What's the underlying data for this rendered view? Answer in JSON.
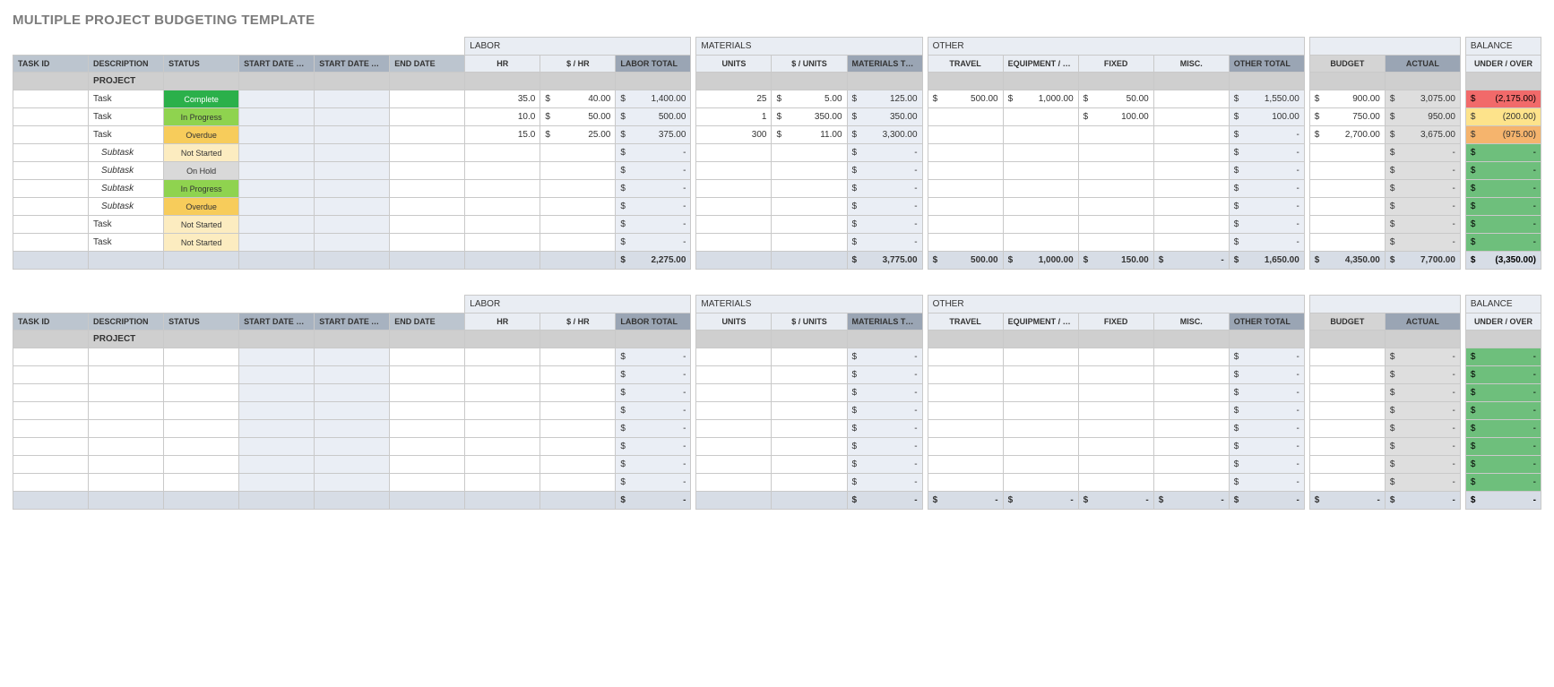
{
  "title": "MULTIPLE PROJECT BUDGETING TEMPLATE",
  "categories": {
    "labor": "LABOR",
    "materials": "MATERIALS",
    "other": "OTHER",
    "balance": "BALANCE"
  },
  "cols": {
    "task_id": "TASK ID",
    "description": "DESCRIPTION",
    "status": "STATUS",
    "start_planned": "START DATE PLANNED",
    "start_actual": "START DATE ACTUAL",
    "end_date": "END DATE",
    "hr": "HR",
    "per_hr": "$ / HR",
    "labor_total": "LABOR TOTAL",
    "units": "UNITS",
    "per_unit": "$ / UNITS",
    "materials_total": "MATERIALS TOTAL",
    "travel": "TRAVEL",
    "equipment": "EQUIPMENT / SPACE",
    "fixed": "FIXED",
    "misc": "MISC.",
    "other_total": "OTHER TOTAL",
    "budget": "BUDGET",
    "actual": "ACTUAL",
    "under_over": "UNDER / OVER"
  },
  "status_labels": {
    "complete": "Complete",
    "inprogress": "In Progress",
    "overdue": "Overdue",
    "notstarted": "Not Started",
    "onhold": "On Hold"
  },
  "projects": [
    {
      "section_label": "PROJECT",
      "rows": [
        {
          "desc": "Task",
          "sub": false,
          "status": "complete",
          "hr": "35.0",
          "per_hr": "40.00",
          "labor_total": "1,400.00",
          "units": "25",
          "per_unit": "5.00",
          "materials_total": "125.00",
          "travel": "500.00",
          "equipment": "1,000.00",
          "fixed": "50.00",
          "misc": "",
          "other_total": "1,550.00",
          "budget": "900.00",
          "actual": "3,075.00",
          "balance": "(2,175.00)",
          "balance_class": "bal-red"
        },
        {
          "desc": "Task",
          "sub": false,
          "status": "inprogress",
          "hr": "10.0",
          "per_hr": "50.00",
          "labor_total": "500.00",
          "units": "1",
          "per_unit": "350.00",
          "materials_total": "350.00",
          "travel": "",
          "equipment": "",
          "fixed": "100.00",
          "misc": "",
          "other_total": "100.00",
          "budget": "750.00",
          "actual": "950.00",
          "balance": "(200.00)",
          "balance_class": "bal-yellow"
        },
        {
          "desc": "Task",
          "sub": false,
          "status": "overdue",
          "hr": "15.0",
          "per_hr": "25.00",
          "labor_total": "375.00",
          "units": "300",
          "per_unit": "11.00",
          "materials_total": "3,300.00",
          "travel": "",
          "equipment": "",
          "fixed": "",
          "misc": "",
          "other_total": "-",
          "budget": "2,700.00",
          "actual": "3,675.00",
          "balance": "(975.00)",
          "balance_class": "bal-orange"
        },
        {
          "desc": "Subtask",
          "sub": true,
          "status": "notstarted",
          "hr": "",
          "per_hr": "",
          "labor_total": "-",
          "units": "",
          "per_unit": "",
          "materials_total": "-",
          "travel": "",
          "equipment": "",
          "fixed": "",
          "misc": "",
          "other_total": "-",
          "budget": "",
          "actual": "-",
          "balance": "-",
          "balance_class": "bal-green"
        },
        {
          "desc": "Subtask",
          "sub": true,
          "status": "onhold",
          "hr": "",
          "per_hr": "",
          "labor_total": "-",
          "units": "",
          "per_unit": "",
          "materials_total": "-",
          "travel": "",
          "equipment": "",
          "fixed": "",
          "misc": "",
          "other_total": "-",
          "budget": "",
          "actual": "-",
          "balance": "-",
          "balance_class": "bal-green"
        },
        {
          "desc": "Subtask",
          "sub": true,
          "status": "inprogress",
          "hr": "",
          "per_hr": "",
          "labor_total": "-",
          "units": "",
          "per_unit": "",
          "materials_total": "-",
          "travel": "",
          "equipment": "",
          "fixed": "",
          "misc": "",
          "other_total": "-",
          "budget": "",
          "actual": "-",
          "balance": "-",
          "balance_class": "bal-green"
        },
        {
          "desc": "Subtask",
          "sub": true,
          "status": "overdue",
          "hr": "",
          "per_hr": "",
          "labor_total": "-",
          "units": "",
          "per_unit": "",
          "materials_total": "-",
          "travel": "",
          "equipment": "",
          "fixed": "",
          "misc": "",
          "other_total": "-",
          "budget": "",
          "actual": "-",
          "balance": "-",
          "balance_class": "bal-green"
        },
        {
          "desc": "Task",
          "sub": false,
          "status": "notstarted",
          "hr": "",
          "per_hr": "",
          "labor_total": "-",
          "units": "",
          "per_unit": "",
          "materials_total": "-",
          "travel": "",
          "equipment": "",
          "fixed": "",
          "misc": "",
          "other_total": "-",
          "budget": "",
          "actual": "-",
          "balance": "-",
          "balance_class": "bal-green"
        },
        {
          "desc": "Task",
          "sub": false,
          "status": "notstarted",
          "hr": "",
          "per_hr": "",
          "labor_total": "-",
          "units": "",
          "per_unit": "",
          "materials_total": "-",
          "travel": "",
          "equipment": "",
          "fixed": "",
          "misc": "",
          "other_total": "-",
          "budget": "",
          "actual": "-",
          "balance": "-",
          "balance_class": "bal-green"
        }
      ],
      "totals": {
        "labor_total": "2,275.00",
        "materials_total": "3,775.00",
        "travel": "500.00",
        "equipment": "1,000.00",
        "fixed": "150.00",
        "misc": "-",
        "other_total": "1,650.00",
        "budget": "4,350.00",
        "actual": "7,700.00",
        "balance": "(3,350.00)",
        "balance_class": "bal-red"
      }
    },
    {
      "section_label": "PROJECT",
      "rows": [
        {
          "desc": "",
          "sub": false,
          "status": "",
          "hr": "",
          "per_hr": "",
          "labor_total": "-",
          "units": "",
          "per_unit": "",
          "materials_total": "-",
          "travel": "",
          "equipment": "",
          "fixed": "",
          "misc": "",
          "other_total": "-",
          "budget": "",
          "actual": "-",
          "balance": "-",
          "balance_class": "bal-green"
        },
        {
          "desc": "",
          "sub": false,
          "status": "",
          "hr": "",
          "per_hr": "",
          "labor_total": "-",
          "units": "",
          "per_unit": "",
          "materials_total": "-",
          "travel": "",
          "equipment": "",
          "fixed": "",
          "misc": "",
          "other_total": "-",
          "budget": "",
          "actual": "-",
          "balance": "-",
          "balance_class": "bal-green"
        },
        {
          "desc": "",
          "sub": false,
          "status": "",
          "hr": "",
          "per_hr": "",
          "labor_total": "-",
          "units": "",
          "per_unit": "",
          "materials_total": "-",
          "travel": "",
          "equipment": "",
          "fixed": "",
          "misc": "",
          "other_total": "-",
          "budget": "",
          "actual": "-",
          "balance": "-",
          "balance_class": "bal-green"
        },
        {
          "desc": "",
          "sub": false,
          "status": "",
          "hr": "",
          "per_hr": "",
          "labor_total": "-",
          "units": "",
          "per_unit": "",
          "materials_total": "-",
          "travel": "",
          "equipment": "",
          "fixed": "",
          "misc": "",
          "other_total": "-",
          "budget": "",
          "actual": "-",
          "balance": "-",
          "balance_class": "bal-green"
        },
        {
          "desc": "",
          "sub": false,
          "status": "",
          "hr": "",
          "per_hr": "",
          "labor_total": "-",
          "units": "",
          "per_unit": "",
          "materials_total": "-",
          "travel": "",
          "equipment": "",
          "fixed": "",
          "misc": "",
          "other_total": "-",
          "budget": "",
          "actual": "-",
          "balance": "-",
          "balance_class": "bal-green"
        },
        {
          "desc": "",
          "sub": false,
          "status": "",
          "hr": "",
          "per_hr": "",
          "labor_total": "-",
          "units": "",
          "per_unit": "",
          "materials_total": "-",
          "travel": "",
          "equipment": "",
          "fixed": "",
          "misc": "",
          "other_total": "-",
          "budget": "",
          "actual": "-",
          "balance": "-",
          "balance_class": "bal-green"
        },
        {
          "desc": "",
          "sub": false,
          "status": "",
          "hr": "",
          "per_hr": "",
          "labor_total": "-",
          "units": "",
          "per_unit": "",
          "materials_total": "-",
          "travel": "",
          "equipment": "",
          "fixed": "",
          "misc": "",
          "other_total": "-",
          "budget": "",
          "actual": "-",
          "balance": "-",
          "balance_class": "bal-green"
        },
        {
          "desc": "",
          "sub": false,
          "status": "",
          "hr": "",
          "per_hr": "",
          "labor_total": "-",
          "units": "",
          "per_unit": "",
          "materials_total": "-",
          "travel": "",
          "equipment": "",
          "fixed": "",
          "misc": "",
          "other_total": "-",
          "budget": "",
          "actual": "-",
          "balance": "-",
          "balance_class": "bal-green"
        }
      ],
      "totals": {
        "labor_total": "-",
        "materials_total": "-",
        "travel": "-",
        "equipment": "-",
        "fixed": "-",
        "misc": "-",
        "other_total": "-",
        "budget": "-",
        "actual": "-",
        "balance": "-",
        "balance_class": "bal-red"
      }
    }
  ]
}
